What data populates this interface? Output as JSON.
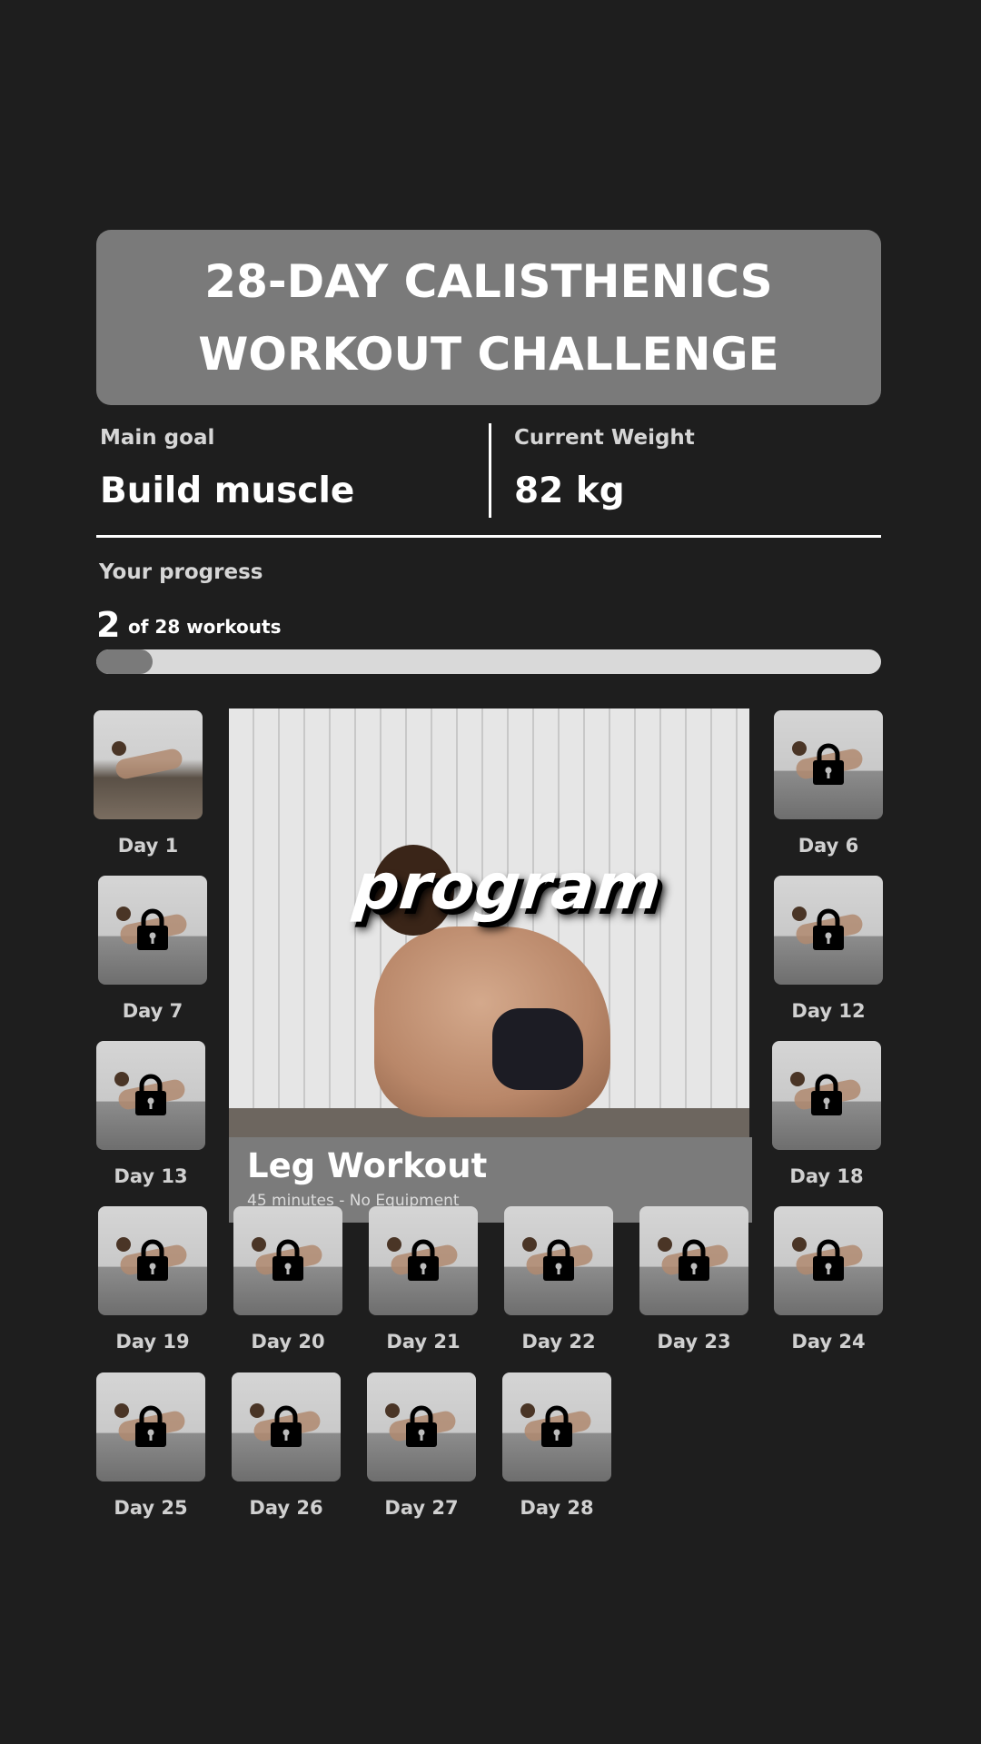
{
  "header": {
    "title": "28-DAY CALISTHENICS WORKOUT CHALLENGE"
  },
  "stats": {
    "goal_label": "Main goal",
    "goal_value": "Build muscle",
    "weight_label": "Current Weight",
    "weight_value": "82 kg"
  },
  "progress": {
    "label": "Your progress",
    "completed": "2",
    "text": "of 28 workouts",
    "fraction": 0.0714
  },
  "featured": {
    "overlay_text": "program",
    "title": "Leg Workout",
    "subtitle": "45 minutes - No Equipment"
  },
  "days": [
    {
      "label": "Day 1",
      "locked": false
    },
    {
      "label": "Day 6",
      "locked": true
    },
    {
      "label": "Day 7",
      "locked": true
    },
    {
      "label": "Day 12",
      "locked": true
    },
    {
      "label": "Day 13",
      "locked": true
    },
    {
      "label": "Day 18",
      "locked": true
    },
    {
      "label": "Day 19",
      "locked": true
    },
    {
      "label": "Day 20",
      "locked": true
    },
    {
      "label": "Day 21",
      "locked": true
    },
    {
      "label": "Day 22",
      "locked": true
    },
    {
      "label": "Day 23",
      "locked": true
    },
    {
      "label": "Day 24",
      "locked": true
    },
    {
      "label": "Day 25",
      "locked": true
    },
    {
      "label": "Day 26",
      "locked": true
    },
    {
      "label": "Day 27",
      "locked": true
    },
    {
      "label": "Day 28",
      "locked": true
    }
  ],
  "icons": {
    "lock": "lock-icon"
  },
  "colors": {
    "background": "#1e1e1e",
    "card": "#7a7a7a",
    "track": "#d9d9d9"
  }
}
